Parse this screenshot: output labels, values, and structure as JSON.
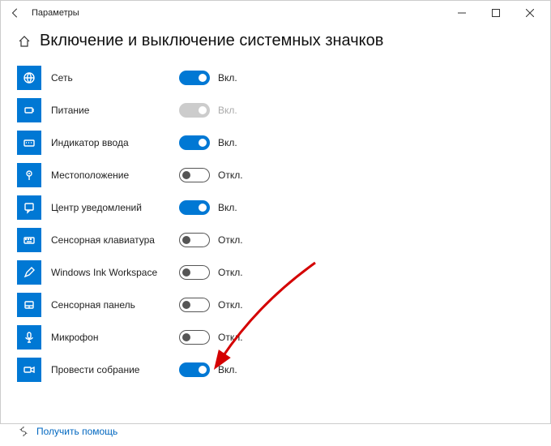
{
  "window": {
    "title": "Параметры"
  },
  "page": {
    "title": "Включение и выключение системных значков"
  },
  "labels": {
    "on": "Вкл.",
    "off": "Откл."
  },
  "items": [
    {
      "id": "network",
      "label": "Сеть",
      "state": "on",
      "icon": "globe"
    },
    {
      "id": "power",
      "label": "Питание",
      "state": "disabled",
      "icon": "power"
    },
    {
      "id": "input",
      "label": "Индикатор ввода",
      "state": "on",
      "icon": "keyboard-lang"
    },
    {
      "id": "location",
      "label": "Местоположение",
      "state": "off",
      "icon": "pin"
    },
    {
      "id": "action",
      "label": "Центр уведомлений",
      "state": "on",
      "icon": "action-center"
    },
    {
      "id": "touchkey",
      "label": "Сенсорная клавиатура",
      "state": "off",
      "icon": "keyboard"
    },
    {
      "id": "ink",
      "label": "Windows Ink Workspace",
      "state": "off",
      "icon": "pen"
    },
    {
      "id": "touchpad",
      "label": "Сенсорная панель",
      "state": "off",
      "icon": "touchpad"
    },
    {
      "id": "microphone",
      "label": "Микрофон",
      "state": "off",
      "icon": "mic"
    },
    {
      "id": "meetnow",
      "label": "Провести собрание",
      "state": "on",
      "icon": "meet"
    }
  ],
  "help": {
    "label": "Получить помощь"
  }
}
